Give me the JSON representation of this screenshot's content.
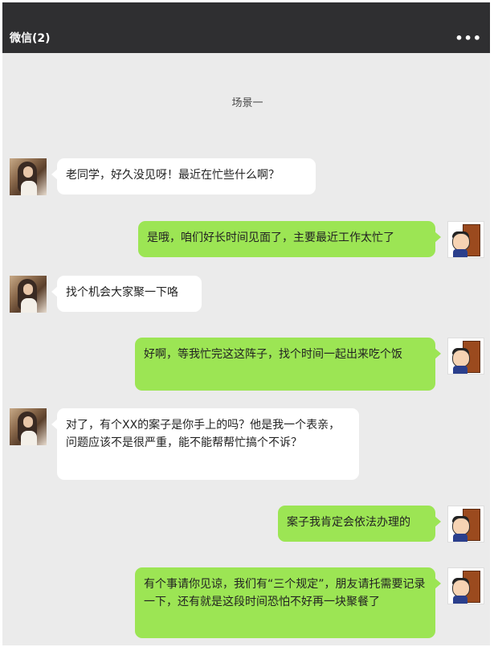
{
  "header": {
    "title": "微信(2)",
    "more_label": "•••"
  },
  "scene_label": "场景一",
  "messages": [
    {
      "side": "left",
      "text": "老同学，好久没见呀！最近在忙些什么啊？"
    },
    {
      "side": "right",
      "text": "是哦，咱们好长时间见面了，主要最近工作太忙了"
    },
    {
      "side": "left",
      "text": "找个机会大家聚一下咯"
    },
    {
      "side": "right",
      "text": "好啊，等我忙完这这阵子，找个时间一起出来吃个饭"
    },
    {
      "side": "left",
      "text": "对了，有个XX的案子是你手上的吗？他是我一个表亲，问题应该不是很严重，能不能帮帮忙搞个不诉？"
    },
    {
      "side": "right",
      "text": "案子我肯定会依法办理的"
    },
    {
      "side": "right",
      "text": "有个事请你见谅，我们有“三个规定”，朋友请托需要记录一下，还有就是这段时间恐怕不好再一块聚餐了"
    }
  ]
}
